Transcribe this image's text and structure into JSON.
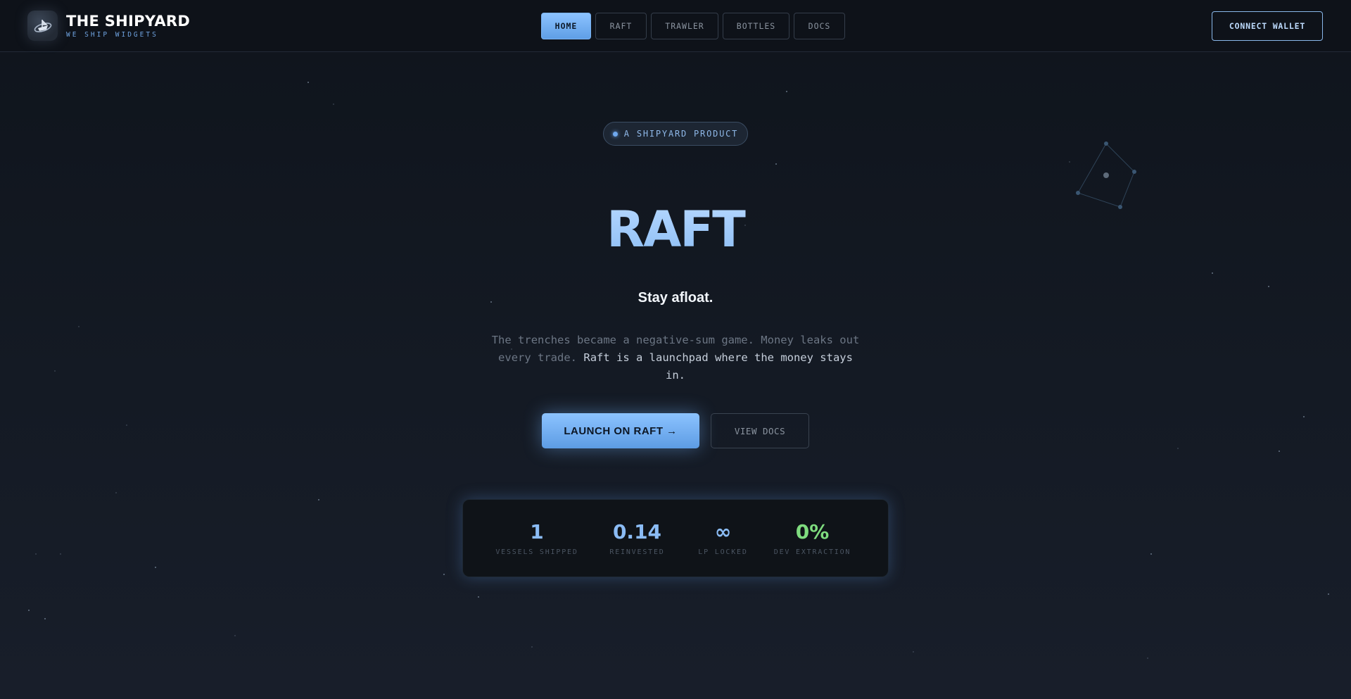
{
  "header": {
    "brand_title": "THE SHIPYARD",
    "brand_subtitle": "WE SHIP WIDGETS",
    "logo_icon": "ship-logo",
    "nav": [
      {
        "label": "HOME",
        "active": true
      },
      {
        "label": "RAFT",
        "active": false
      },
      {
        "label": "TRAWLER",
        "active": false
      },
      {
        "label": "BOTTLES",
        "active": false
      },
      {
        "label": "DOCS",
        "active": false
      }
    ],
    "connect_label": "CONNECT WALLET"
  },
  "hero": {
    "badge": "A SHIPYARD PRODUCT",
    "title": "RAFT",
    "tagline": "Stay afloat.",
    "description_muted": "The trenches became a negative-sum game. Money leaks out every trade. ",
    "description_highlight": "Raft is a launchpad where the money stays in.",
    "cta_primary": "LAUNCH ON RAFT →",
    "cta_secondary": "VIEW DOCS"
  },
  "stats": [
    {
      "value": "1",
      "label": "VESSELS SHIPPED"
    },
    {
      "value": "0.14",
      "label": "REINVESTED"
    },
    {
      "value": "∞",
      "label": "LP LOCKED"
    },
    {
      "value": "0%",
      "label": "DEV EXTRACTION"
    }
  ],
  "colors": {
    "accent": "#8cc3ff",
    "accent_dark": "#5d9ce4",
    "success": "#7fdc7f",
    "background": "#131922"
  }
}
